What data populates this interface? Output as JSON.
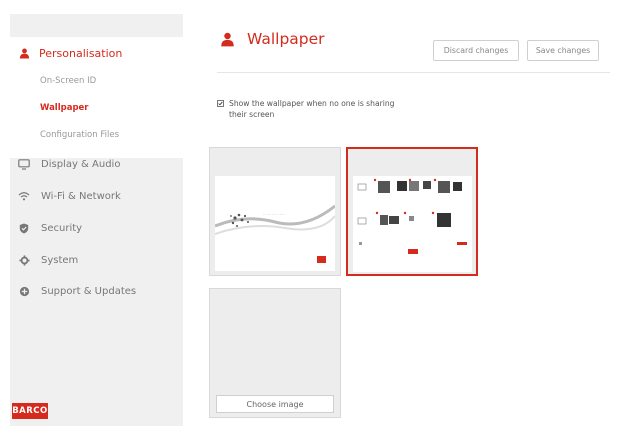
{
  "sidebar": {
    "active_section": "Personalisation",
    "subitems": [
      {
        "label": "On-Screen ID",
        "active": false
      },
      {
        "label": "Wallpaper",
        "active": true
      },
      {
        "label": "Configuration Files",
        "active": false
      }
    ],
    "items": [
      {
        "label": "Display & Audio",
        "icon": "monitor-icon"
      },
      {
        "label": "Wi-Fi & Network",
        "icon": "wifi-icon"
      },
      {
        "label": "Security",
        "icon": "shield-icon"
      },
      {
        "label": "System",
        "icon": "gear-icon"
      },
      {
        "label": "Support & Updates",
        "icon": "plus-circle-icon"
      }
    ],
    "logo": "BARCO"
  },
  "main": {
    "title": "Wallpaper",
    "title_icon": "person-icon",
    "discard_label": "Discard changes",
    "save_label": "Save changes",
    "show_wallpaper_label": "Show the wallpaper when no one is sharing their screen",
    "show_wallpaper_checked": true,
    "wallpapers": [
      {
        "name": "wallpaper-swirl",
        "selected": false
      },
      {
        "name": "wallpaper-instructions",
        "selected": true
      }
    ],
    "choose_image_label": "Choose image"
  },
  "colors": {
    "accent": "#d52b1e",
    "sidebar_bg": "#f0f0f0",
    "tile_bg": "#ededed"
  }
}
